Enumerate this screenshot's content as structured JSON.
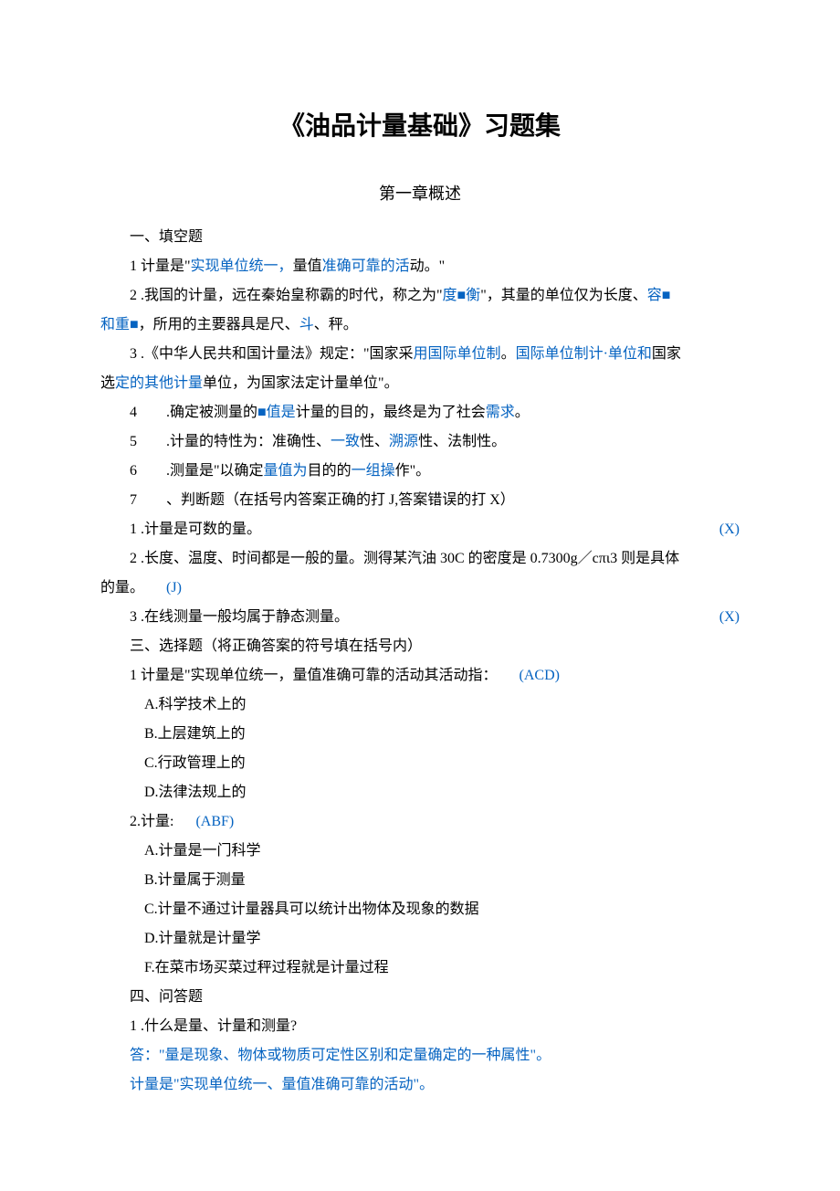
{
  "title": "《油品计量基础》习题集",
  "subtitle": "第一章概述",
  "sec1_header": "一、填空题",
  "fill": {
    "q1_a": "1 计量是\"",
    "q1_b": "实现单位统一，",
    "q1_c": "量值",
    "q1_d": "准确可靠的活",
    "q1_e": "动。\"",
    "q2_a": "2 .我国的计量，远在秦始皇称霸的时代，称之为\"",
    "q2_b": "度■衡",
    "q2_c": "\"，其量的单位仅为长度、",
    "q2_d": "容■",
    "q3_a": "和重■",
    "q3_b": "，所用的主要器具是尺、",
    "q3_c": "斗",
    "q3_d": "、秤。",
    "q4_a": "3 .《中华人民共和国计量法》规定：\"国家采",
    "q4_b": "用国际单位制",
    "q4_c": "。",
    "q4_d": "国际单位制计·单位和",
    "q4_e": "国家",
    "q5_a": "选",
    "q5_b": "定的其他计量",
    "q5_c": "单位，为国家法定计量单位\"。",
    "q6_a": "4  .确定被测量的",
    "q6_b": "■值是",
    "q6_c": "计量的目的，最终是为了社会",
    "q6_d": "需求",
    "q6_e": "。",
    "q7_a": "5  .计量的特性为：准确性、",
    "q7_b": "一致",
    "q7_c": "性、",
    "q7_d": "溯源",
    "q7_e": "性、法制性。",
    "q8_a": "6  .测量是\"以确定",
    "q8_b": "量值为",
    "q8_c": "目的的",
    "q8_d": "一组操",
    "q8_e": "作\"。",
    "q9": "7  、判断题（在括号内答案正确的打 J,答案错误的打 X）"
  },
  "judge": {
    "j1_text": "1 .计量是可数的量。",
    "j1_ans": "(X)",
    "j2_a": "2 .长度、温度、时间都是一般的量。测得某汽油 30C 的密度是 0.7300g／cπι3 则是具体",
    "j2_b": "的量。",
    "j2_ans": "(J)",
    "j3_text": "3 .在线测量一般均属于静态测量。",
    "j3_ans": "(X)"
  },
  "sec3_header": "三、选择题（将正确答案的符号填在括号内）",
  "choice": {
    "c1_text": "1 计量是\"实现单位统一，量值准确可靠的活动其活动指：",
    "c1_ans": "(ACD)",
    "c1_a": "A.科学技术上的",
    "c1_b": "B.上层建筑上的",
    "c1_c": "C.行政管理上的",
    "c1_d": "D.法律法规上的",
    "c2_text": "2.计量:",
    "c2_ans": "(ABF)",
    "c2_a": "A.计量是一门科学",
    "c2_b": "B.计量属于测量",
    "c2_c": "C.计量不通过计量器具可以统计出物体及现象的数据",
    "c2_d": "D.计量就是计量学",
    "c2_f": "F.在菜市场买菜过秤过程就是计量过程"
  },
  "sec4_header": "四、问答题",
  "qa": {
    "q1": "1 .什么是量、计量和测量?",
    "a1_a": "答：\"量是现象、物体或物质可定性区别和定量确定的一种属性\"。",
    "a1_b": "计量是\"实现单位统一、量值准确可靠的活动\"。"
  }
}
